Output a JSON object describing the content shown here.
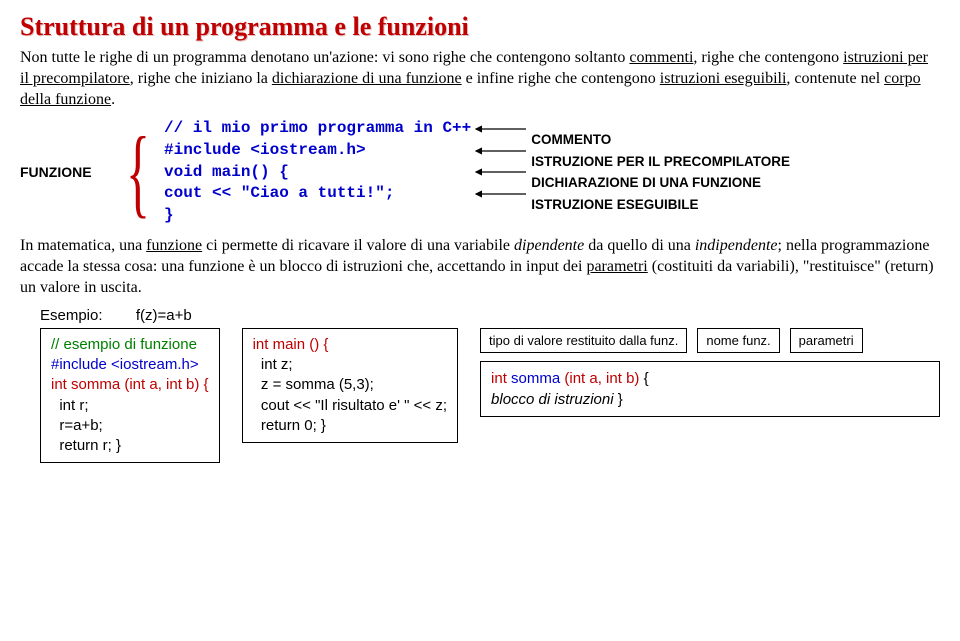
{
  "title": "Struttura di un programma e le funzioni",
  "para1_pre": "Non tutte le righe di un programma denotano un'azione: vi sono righe che contengono soltanto ",
  "para1_u1": "commenti",
  "para1_mid1": ", righe che contengono ",
  "para1_u2": "istruzioni per il precompilatore",
  "para1_mid2": ", righe che iniziano la ",
  "para1_u3": "dichiarazione di una funzione",
  "para1_mid3": " e infine righe che contengono ",
  "para1_u4": "istruzioni eseguibili",
  "para1_mid4": ", contenute nel ",
  "para1_u5": "corpo della funzione",
  "para1_end": ".",
  "funzione_label": "FUNZIONE",
  "code": {
    "l1": "// il mio primo programma in C++",
    "l2": "#include <iostream.h>",
    "l3": "void main() {",
    "l4": "cout << \"Ciao a tutti!\";",
    "l5": "}"
  },
  "annot": {
    "a1": "COMMENTO",
    "a2": "ISTRUZIONE PER IL PRECOMPILATORE",
    "a3": "DICHIARAZIONE DI UNA FUNZIONE",
    "a4": "ISTRUZIONE ESEGUIBILE"
  },
  "para2_pre": "In matematica, una ",
  "para2_u1": "funzione",
  "para2_m1": " ci permette di ricavare il valore di una variabile ",
  "para2_i1": "dipendente",
  "para2_m2": " da quello di una ",
  "para2_i2": "indipendente",
  "para2_m3": "; nella programmazione accade la stessa cosa: una funzione è un blocco di istruzioni che, accettando in input dei ",
  "para2_u2": "parametri",
  "para2_m4": " (costituiti da variabili), \"restituisce\" (return) un valore in uscita.",
  "example_label": "Esempio:",
  "example_fn": "f(z)=a+b",
  "box1": {
    "l1": "// esempio di funzione",
    "l2": "#include <iostream.h>",
    "l3": "int somma (int a, int b) {",
    "l4": "  int r;",
    "l5": "  r=a+b;",
    "l6": "  return r; }"
  },
  "box2": {
    "l1": "int main () {",
    "l2": "  int z;",
    "l3": "  z = somma (5,3);",
    "l4": "  cout << \"Il risultato e' \" << z;",
    "l5": "  return 0; }"
  },
  "sb1": "tipo di valore\nrestituito\ndalla funz.",
  "sb2": "nome\nfunz.",
  "sb3": "parametri",
  "sig_int": "int ",
  "sig_name": "somma ",
  "sig_par": "(int a, int b)",
  "sig_brace": " {",
  "sig_body": "blocco di istruzioni",
  "sig_close": " }"
}
